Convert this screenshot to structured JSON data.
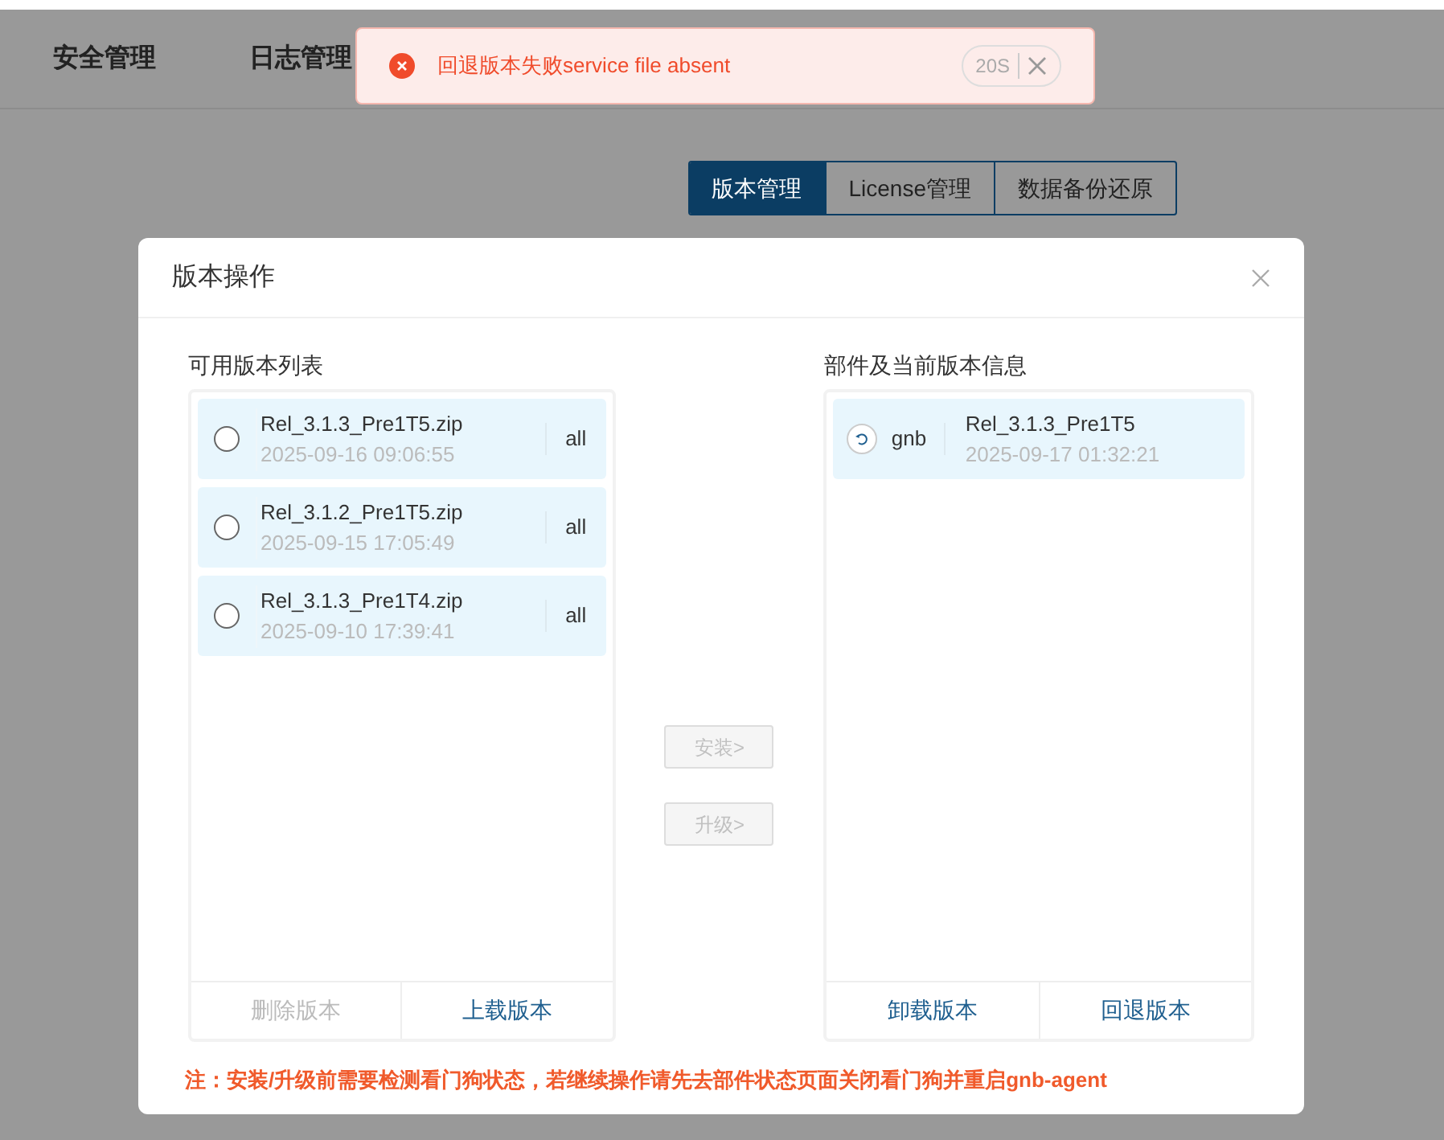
{
  "nav": [
    {
      "label": "安全管理"
    },
    {
      "label": "日志管理"
    }
  ],
  "toast": {
    "message": "回退版本失败service file absent",
    "countdown": "20S"
  },
  "tabs": [
    {
      "label": "版本管理",
      "selected": true
    },
    {
      "label": "License管理",
      "selected": false
    },
    {
      "label": "数据备份还原",
      "selected": false
    }
  ],
  "dialog": {
    "title": "版本操作",
    "left": {
      "title": "可用版本列表",
      "items": [
        {
          "name": "Rel_3.1.3_Pre1T5.zip",
          "date": "2025-09-16 09:06:55",
          "scope": "all",
          "selected": false
        },
        {
          "name": "Rel_3.1.2_Pre1T5.zip",
          "date": "2025-09-15 17:05:49",
          "scope": "all",
          "selected": false
        },
        {
          "name": "Rel_3.1.3_Pre1T4.zip",
          "date": "2025-09-10 17:39:41",
          "scope": "all",
          "selected": false
        }
      ],
      "actions": [
        {
          "label": "删除版本",
          "disabled": true
        },
        {
          "label": "上载版本",
          "disabled": false
        }
      ]
    },
    "transfer": [
      {
        "label": "安装>",
        "disabled": true
      },
      {
        "label": "升级>",
        "disabled": true
      }
    ],
    "right": {
      "title": "部件及当前版本信息",
      "items": [
        {
          "component": "gnb",
          "version": "Rel_3.1.3_Pre1T5",
          "date": "2025-09-17 01:32:21"
        }
      ],
      "actions": [
        {
          "label": "卸载版本",
          "disabled": false
        },
        {
          "label": "回退版本",
          "disabled": false
        }
      ]
    },
    "note": "注：安装/升级前需要检测看门狗状态，若继续操作请先去部件状态页面关闭看门狗并重启gnb-agent"
  }
}
